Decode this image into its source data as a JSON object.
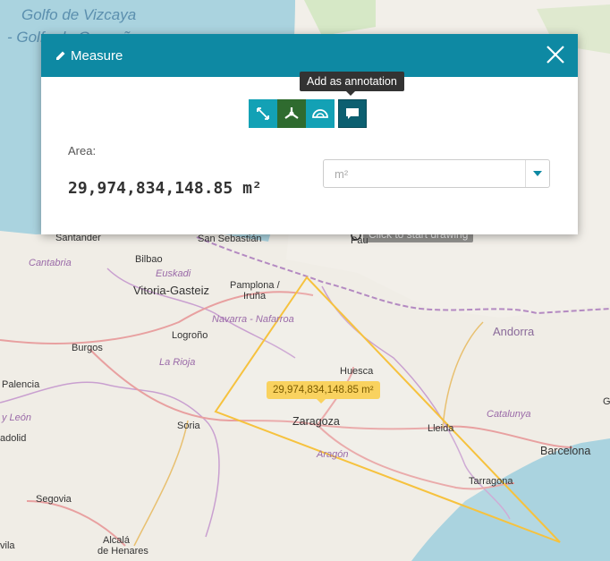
{
  "map": {
    "sea_labels": [
      "Golfo de Vizcaya",
      "- Golfo de Gascuña"
    ],
    "places": {
      "santander": "Santander",
      "cantabria": "Cantabria",
      "bilbao": "Bilbao",
      "euskadi": "Euskadi",
      "san_sebastian": "San Sebastián",
      "pau": "Pau",
      "vitoria": "Vitoria-Gasteiz",
      "pamplona": "Pamplona /",
      "irunea": "Iruña",
      "navarra": "Navarra - Nafarroa",
      "logrono": "Logroño",
      "burgos": "Burgos",
      "la_rioja": "La Rioja",
      "andorra": "Andorra",
      "huesca": "Huesca",
      "palencia": "Palencia",
      "leon": "y León",
      "dolid": "adolid",
      "soria": "Soria",
      "zaragoza": "Zaragoza",
      "aragon": "Aragón",
      "lleida": "Lleida",
      "catalunya": "Catalunya",
      "barcelona": "Barcelona",
      "tarragona": "Tarragona",
      "segovia": "Segovia",
      "alcala1": "Alcalá",
      "alcala2": "de Henares",
      "avila": "vila",
      "g": "G"
    },
    "hint": "Click to start drawing",
    "measure_tooltip": "29,974,834,148.85 m²"
  },
  "dialog": {
    "title": "Measure",
    "tooltip": "Add as annotation",
    "area_label": "Area:",
    "area_value": "29,974,834,148.85 m²",
    "unit_placeholder": "m²"
  },
  "colors": {
    "header": "#0e89a3",
    "measure": "#f9c74f"
  }
}
